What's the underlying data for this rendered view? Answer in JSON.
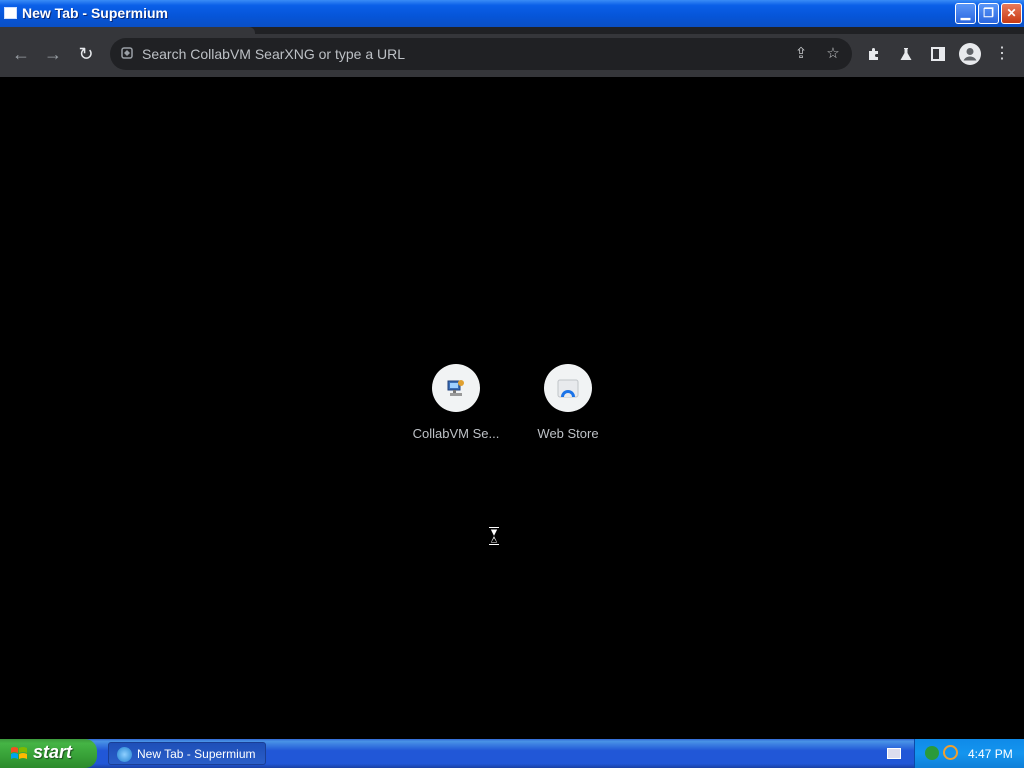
{
  "window": {
    "title": "New Tab - Supermium",
    "minimize_icon": "minimize-icon",
    "restore_icon": "restore-icon",
    "close_icon": "close-icon"
  },
  "toolbar": {
    "back_icon": "arrow-left-icon",
    "forward_icon": "arrow-right-icon",
    "reload_icon": "reload-icon",
    "omnibox_placeholder": "Search CollabVM SearXNG or type a URL",
    "share_icon": "share-icon",
    "bookmark_icon": "star-icon",
    "extensions_icon": "puzzle-icon",
    "labs_icon": "flask-icon",
    "sidepanel_icon": "sidepanel-icon",
    "profile_icon": "profile-icon",
    "menu_icon": "kebab-menu-icon"
  },
  "shortcuts": [
    {
      "label": "CollabVM Se...",
      "icon": "collabvm-icon"
    },
    {
      "label": "Web Store",
      "icon": "webstore-icon"
    }
  ],
  "taskbar": {
    "start_label": "start",
    "task_label": "New Tab - Supermium",
    "clock": "4:47 PM"
  },
  "colors": {
    "page_background": "#000000",
    "toolbar": "#35363a",
    "omnibox": "#202124",
    "xp_blue": "#2157d7",
    "start_green": "#37a037"
  }
}
